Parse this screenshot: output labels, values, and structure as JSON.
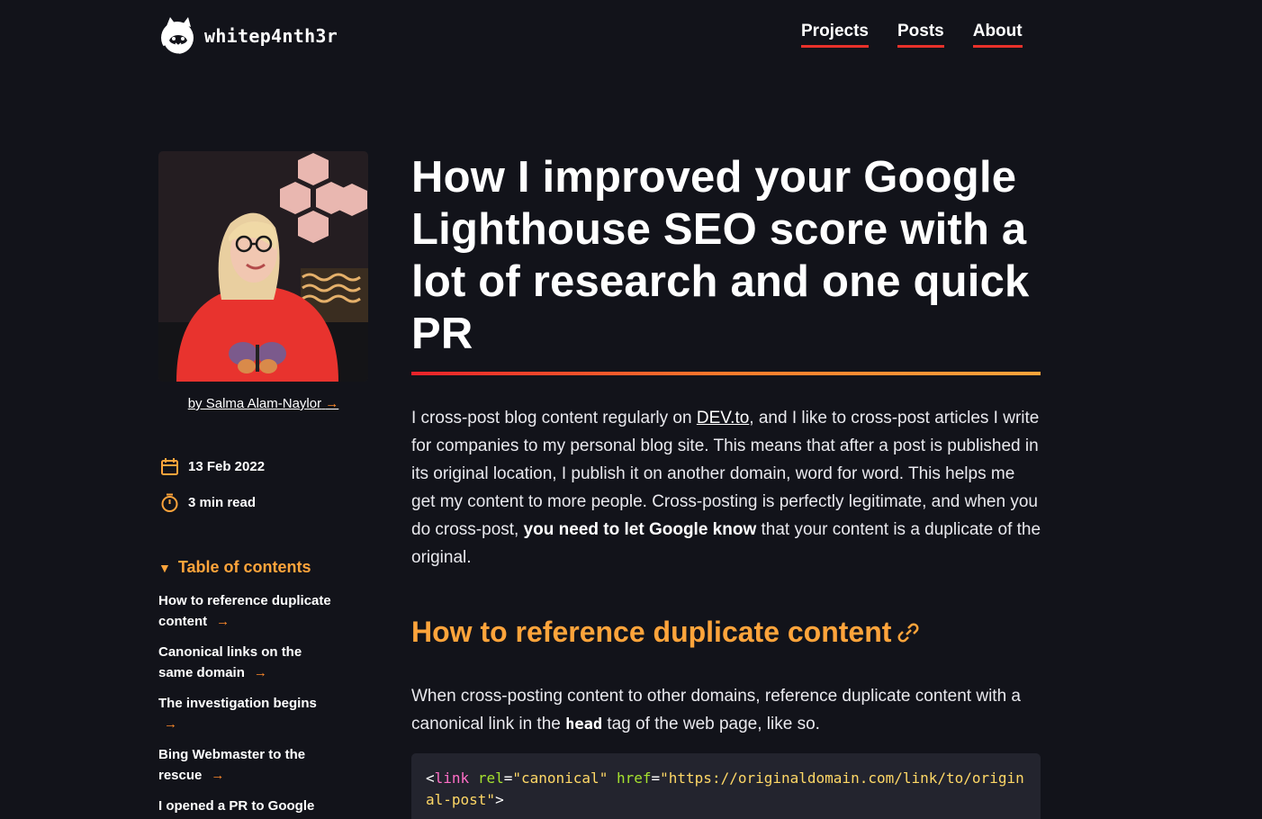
{
  "header": {
    "logo_text": "whitep4nth3r",
    "nav": [
      "Projects",
      "Posts",
      "About"
    ]
  },
  "sidebar": {
    "author_link": "by Salma Alam-Naylor",
    "date": "13 Feb 2022",
    "read_time": "3 min read",
    "toc_title": "Table of contents",
    "toc_items": [
      "How to reference duplicate content",
      "Canonical links on the same domain",
      "The investigation begins",
      "Bing Webmaster to the rescue",
      "I opened a PR to Google"
    ]
  },
  "article": {
    "title": "How I improved your Google Lighthouse SEO score with a lot of research and one quick PR",
    "intro_1": "I cross-post blog content regularly on ",
    "intro_link": "DEV.to",
    "intro_2": ", and I like to cross-post articles I write for companies to my personal blog site. This means that after a post is published in its original location, I publish it on another domain, word for word. This helps me get my content to more people. Cross-posting is perfectly legitimate, and when you do cross-post, ",
    "intro_bold": "you need to let Google know",
    "intro_3": " that your content is a duplicate of the original.",
    "h2": "How to reference duplicate content",
    "p2_1": "When cross-posting content to other domains, reference duplicate content with a canonical link in the ",
    "p2_code": "head",
    "p2_2": " tag of the web page, like so.",
    "code": {
      "open": "<",
      "tag": "link",
      "attr1": "rel",
      "eq1": "=",
      "val1": "\"canonical\"",
      "attr2": "href",
      "eq2": "=",
      "val2a": "\"https://originaldomain.com/link/to/origin",
      "val2b": "al-post\"",
      "close": ">"
    }
  },
  "colors": {
    "background": "#12131a",
    "accent_orange": "#ffa43b",
    "accent_red": "#e8312a",
    "code_bg": "#23242e"
  }
}
